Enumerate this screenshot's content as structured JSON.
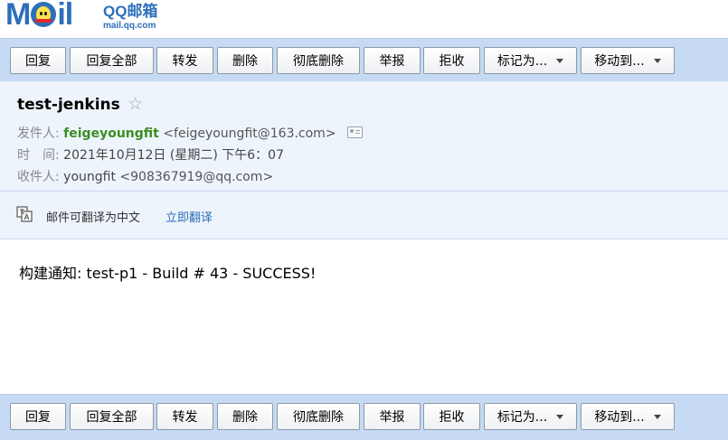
{
  "logo": {
    "word_pre": "M",
    "word_post": "il",
    "title": "QQ邮箱",
    "domain": "mail.qq.com"
  },
  "toolbar": {
    "buttons": [
      {
        "label": "回复",
        "dropdown": false
      },
      {
        "label": "回复全部",
        "dropdown": false
      },
      {
        "label": "转发",
        "dropdown": false
      },
      {
        "label": "删除",
        "dropdown": false
      },
      {
        "label": "彻底删除",
        "dropdown": false
      },
      {
        "label": "举报",
        "dropdown": false
      },
      {
        "label": "拒收",
        "dropdown": false
      },
      {
        "label": "标记为...",
        "dropdown": true
      },
      {
        "label": "移动到...",
        "dropdown": true
      }
    ]
  },
  "mail": {
    "subject": "test-jenkins",
    "from_label": "发件人:",
    "from_name": "feigeyoungfit",
    "from_email": "<feigeyoungfit@163.com>",
    "time_label": "时　间:",
    "time_value": "2021年10月12日 (星期二) 下午6：07",
    "to_label": "收件人:",
    "to_name": "youngfit",
    "to_email": "<908367919@qq.com>",
    "body": "构建通知: test-p1 - Build # 43 - SUCCESS!"
  },
  "translate": {
    "text": "邮件可翻译为中文",
    "link": "立即翻译"
  },
  "colors": {
    "toolbar_bg": "#c6daf3",
    "header_bg": "#eef4fc",
    "sender_green": "#3c8e23",
    "link_blue": "#2b6db8",
    "brand_blue": "#2d6fb9"
  }
}
